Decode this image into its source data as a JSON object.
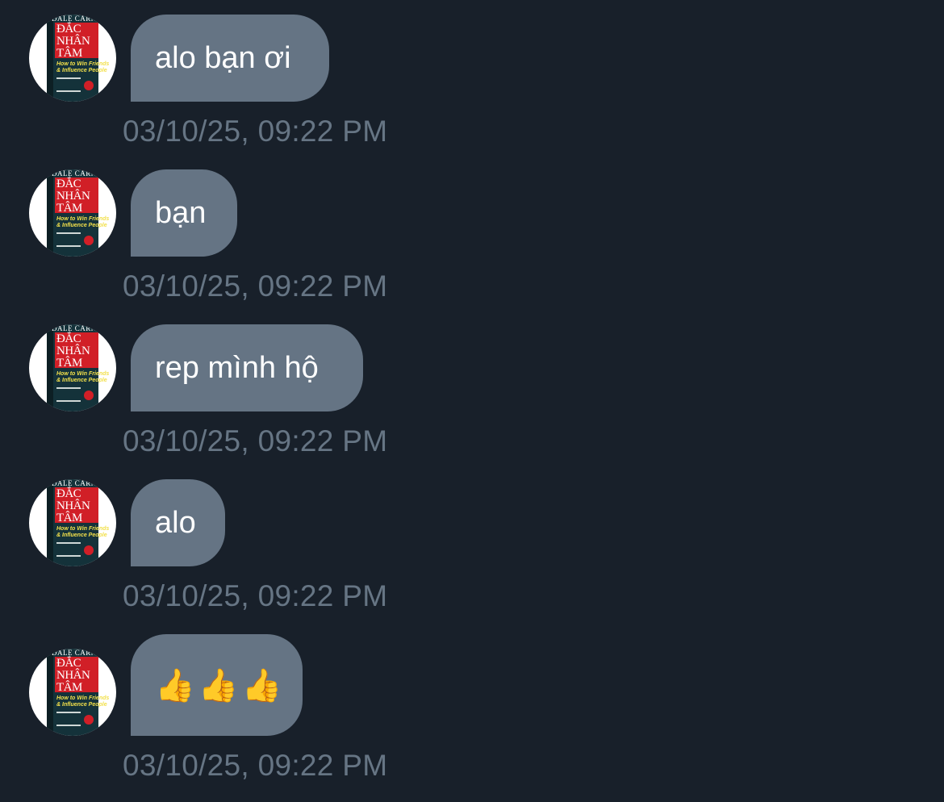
{
  "avatar": {
    "author": "DALE CARNEGIE",
    "title_line1": "ĐẮC",
    "title_line2": "NHÂN",
    "title_line3": "TÂM",
    "subtitle_line1": "How to Win Friends",
    "subtitle_line2": "& Influence People"
  },
  "messages": [
    {
      "text": "alo bạn ơi",
      "time": "03/10/25, 09:22 PM"
    },
    {
      "text": "bạn",
      "time": "03/10/25, 09:22 PM"
    },
    {
      "text": "rep mình hộ",
      "time": "03/10/25, 09:22 PM"
    },
    {
      "text": "alo",
      "time": "03/10/25, 09:22 PM"
    },
    {
      "text": "👍👍👍",
      "time": "03/10/25, 09:22 PM"
    }
  ]
}
